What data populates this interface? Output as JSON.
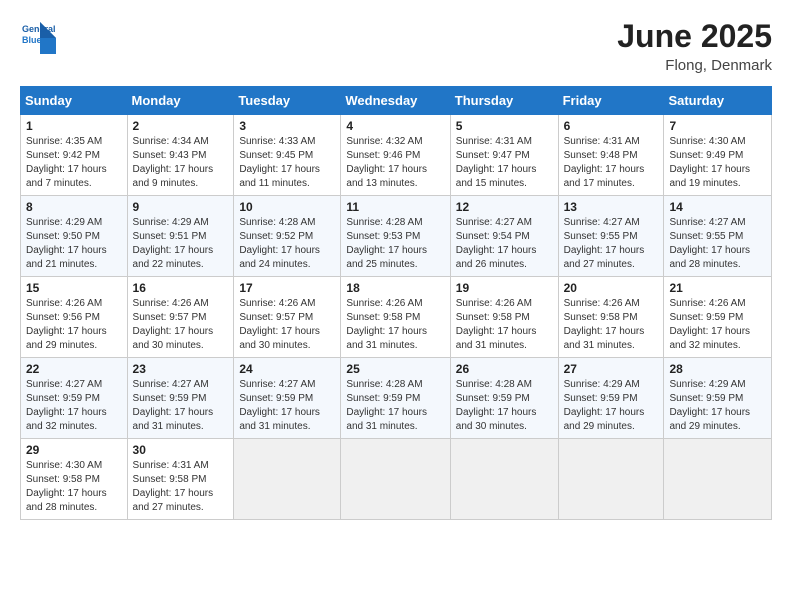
{
  "logo": {
    "line1": "General",
    "line2": "Blue"
  },
  "title": "June 2025",
  "subtitle": "Flong, Denmark",
  "header": {
    "days": [
      "Sunday",
      "Monday",
      "Tuesday",
      "Wednesday",
      "Thursday",
      "Friday",
      "Saturday"
    ]
  },
  "weeks": [
    [
      {
        "day": "1",
        "info": "Sunrise: 4:35 AM\nSunset: 9:42 PM\nDaylight: 17 hours and 7 minutes."
      },
      {
        "day": "2",
        "info": "Sunrise: 4:34 AM\nSunset: 9:43 PM\nDaylight: 17 hours and 9 minutes."
      },
      {
        "day": "3",
        "info": "Sunrise: 4:33 AM\nSunset: 9:45 PM\nDaylight: 17 hours and 11 minutes."
      },
      {
        "day": "4",
        "info": "Sunrise: 4:32 AM\nSunset: 9:46 PM\nDaylight: 17 hours and 13 minutes."
      },
      {
        "day": "5",
        "info": "Sunrise: 4:31 AM\nSunset: 9:47 PM\nDaylight: 17 hours and 15 minutes."
      },
      {
        "day": "6",
        "info": "Sunrise: 4:31 AM\nSunset: 9:48 PM\nDaylight: 17 hours and 17 minutes."
      },
      {
        "day": "7",
        "info": "Sunrise: 4:30 AM\nSunset: 9:49 PM\nDaylight: 17 hours and 19 minutes."
      }
    ],
    [
      {
        "day": "8",
        "info": "Sunrise: 4:29 AM\nSunset: 9:50 PM\nDaylight: 17 hours and 21 minutes."
      },
      {
        "day": "9",
        "info": "Sunrise: 4:29 AM\nSunset: 9:51 PM\nDaylight: 17 hours and 22 minutes."
      },
      {
        "day": "10",
        "info": "Sunrise: 4:28 AM\nSunset: 9:52 PM\nDaylight: 17 hours and 24 minutes."
      },
      {
        "day": "11",
        "info": "Sunrise: 4:28 AM\nSunset: 9:53 PM\nDaylight: 17 hours and 25 minutes."
      },
      {
        "day": "12",
        "info": "Sunrise: 4:27 AM\nSunset: 9:54 PM\nDaylight: 17 hours and 26 minutes."
      },
      {
        "day": "13",
        "info": "Sunrise: 4:27 AM\nSunset: 9:55 PM\nDaylight: 17 hours and 27 minutes."
      },
      {
        "day": "14",
        "info": "Sunrise: 4:27 AM\nSunset: 9:55 PM\nDaylight: 17 hours and 28 minutes."
      }
    ],
    [
      {
        "day": "15",
        "info": "Sunrise: 4:26 AM\nSunset: 9:56 PM\nDaylight: 17 hours and 29 minutes."
      },
      {
        "day": "16",
        "info": "Sunrise: 4:26 AM\nSunset: 9:57 PM\nDaylight: 17 hours and 30 minutes."
      },
      {
        "day": "17",
        "info": "Sunrise: 4:26 AM\nSunset: 9:57 PM\nDaylight: 17 hours and 30 minutes."
      },
      {
        "day": "18",
        "info": "Sunrise: 4:26 AM\nSunset: 9:58 PM\nDaylight: 17 hours and 31 minutes."
      },
      {
        "day": "19",
        "info": "Sunrise: 4:26 AM\nSunset: 9:58 PM\nDaylight: 17 hours and 31 minutes."
      },
      {
        "day": "20",
        "info": "Sunrise: 4:26 AM\nSunset: 9:58 PM\nDaylight: 17 hours and 31 minutes."
      },
      {
        "day": "21",
        "info": "Sunrise: 4:26 AM\nSunset: 9:59 PM\nDaylight: 17 hours and 32 minutes."
      }
    ],
    [
      {
        "day": "22",
        "info": "Sunrise: 4:27 AM\nSunset: 9:59 PM\nDaylight: 17 hours and 32 minutes."
      },
      {
        "day": "23",
        "info": "Sunrise: 4:27 AM\nSunset: 9:59 PM\nDaylight: 17 hours and 31 minutes."
      },
      {
        "day": "24",
        "info": "Sunrise: 4:27 AM\nSunset: 9:59 PM\nDaylight: 17 hours and 31 minutes."
      },
      {
        "day": "25",
        "info": "Sunrise: 4:28 AM\nSunset: 9:59 PM\nDaylight: 17 hours and 31 minutes."
      },
      {
        "day": "26",
        "info": "Sunrise: 4:28 AM\nSunset: 9:59 PM\nDaylight: 17 hours and 30 minutes."
      },
      {
        "day": "27",
        "info": "Sunrise: 4:29 AM\nSunset: 9:59 PM\nDaylight: 17 hours and 29 minutes."
      },
      {
        "day": "28",
        "info": "Sunrise: 4:29 AM\nSunset: 9:59 PM\nDaylight: 17 hours and 29 minutes."
      }
    ],
    [
      {
        "day": "29",
        "info": "Sunrise: 4:30 AM\nSunset: 9:58 PM\nDaylight: 17 hours and 28 minutes."
      },
      {
        "day": "30",
        "info": "Sunrise: 4:31 AM\nSunset: 9:58 PM\nDaylight: 17 hours and 27 minutes."
      },
      {
        "day": "",
        "info": ""
      },
      {
        "day": "",
        "info": ""
      },
      {
        "day": "",
        "info": ""
      },
      {
        "day": "",
        "info": ""
      },
      {
        "day": "",
        "info": ""
      }
    ]
  ]
}
